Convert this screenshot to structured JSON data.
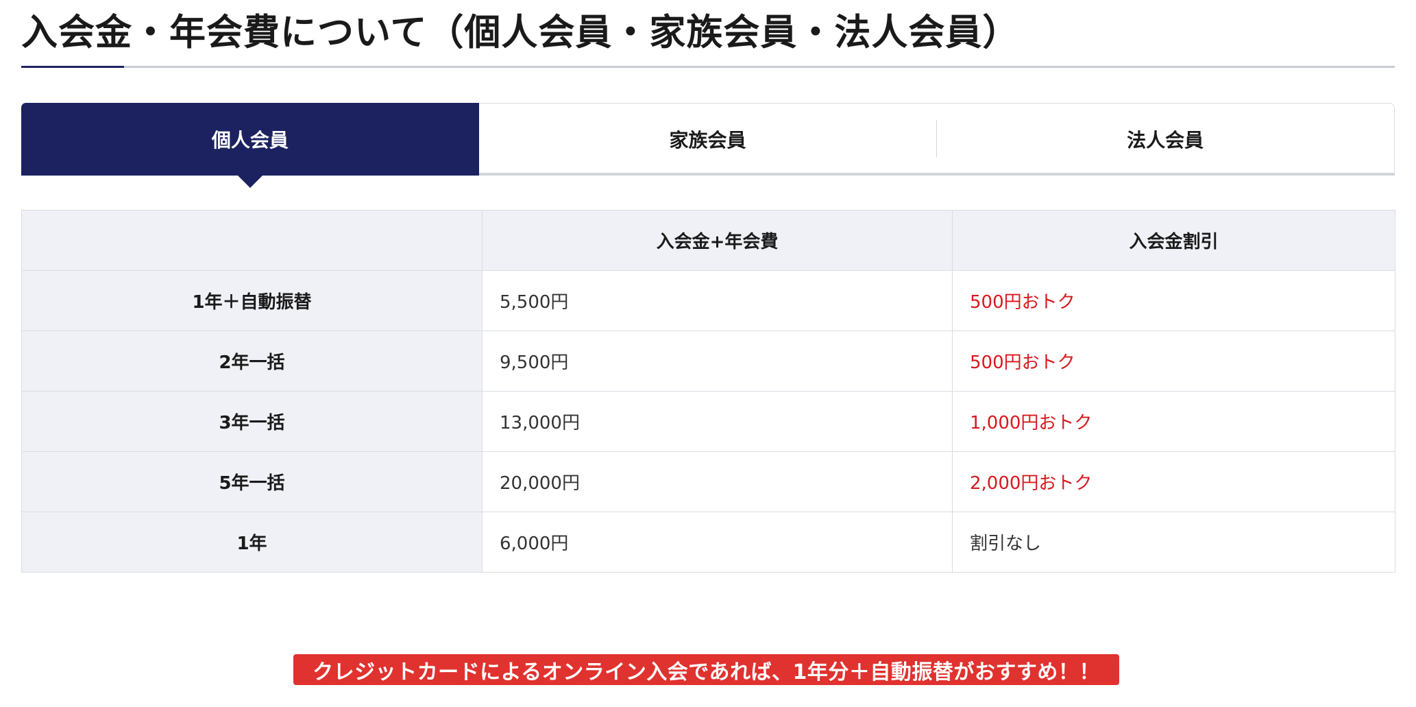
{
  "page": {
    "title": "入会金・年会費について（個人会員・家族会員・法人会員）"
  },
  "tabs": [
    {
      "label": "個人会員",
      "active": true
    },
    {
      "label": "家族会員",
      "active": false
    },
    {
      "label": "法人会員",
      "active": false
    }
  ],
  "table": {
    "headers": [
      "",
      "入会金+年会費",
      "入会金割引"
    ],
    "rows": [
      {
        "plan": "1年＋自動振替",
        "fee": "5,500円",
        "discount": "500円おトク"
      },
      {
        "plan": "2年一括",
        "fee": "9,500円",
        "discount": "500円おトク"
      },
      {
        "plan": "3年一括",
        "fee": "13,000円",
        "discount": "1,000円おトク"
      },
      {
        "plan": "5年一括",
        "fee": "20,000円",
        "discount": "2,000円おトク"
      },
      {
        "plan": "1年",
        "fee": "6,000円",
        "discount": "割引なし"
      }
    ]
  },
  "banner": {
    "text": "クレジットカードによるオンライン入会であれば、1年分＋自動振替がおすすめ！！"
  },
  "colors": {
    "navy": "#1c2260",
    "discount_red": "#d7191e",
    "banner_red": "#e0322f",
    "header_bg": "#f0f1f6"
  }
}
